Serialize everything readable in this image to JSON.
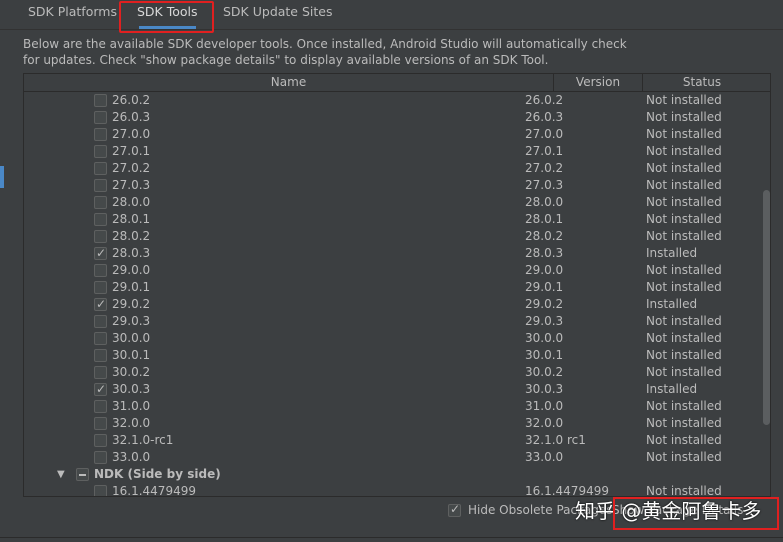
{
  "tabs": [
    {
      "label": "SDK Platforms"
    },
    {
      "label": "SDK Tools"
    },
    {
      "label": "SDK Update Sites"
    }
  ],
  "description": {
    "line1": "Below are the available SDK developer tools. Once installed, Android Studio will automatically check",
    "line2": "for updates. Check \"show package details\" to display available versions of an SDK Tool."
  },
  "table": {
    "headers": {
      "name": "Name",
      "version": "Version",
      "status": "Status"
    },
    "rows": [
      {
        "name": "26.0.2",
        "version": "26.0.2",
        "status": "Not installed",
        "checked": false
      },
      {
        "name": "26.0.3",
        "version": "26.0.3",
        "status": "Not installed",
        "checked": false
      },
      {
        "name": "27.0.0",
        "version": "27.0.0",
        "status": "Not installed",
        "checked": false
      },
      {
        "name": "27.0.1",
        "version": "27.0.1",
        "status": "Not installed",
        "checked": false
      },
      {
        "name": "27.0.2",
        "version": "27.0.2",
        "status": "Not installed",
        "checked": false
      },
      {
        "name": "27.0.3",
        "version": "27.0.3",
        "status": "Not installed",
        "checked": false
      },
      {
        "name": "28.0.0",
        "version": "28.0.0",
        "status": "Not installed",
        "checked": false
      },
      {
        "name": "28.0.1",
        "version": "28.0.1",
        "status": "Not installed",
        "checked": false
      },
      {
        "name": "28.0.2",
        "version": "28.0.2",
        "status": "Not installed",
        "checked": false
      },
      {
        "name": "28.0.3",
        "version": "28.0.3",
        "status": "Installed",
        "checked": true
      },
      {
        "name": "29.0.0",
        "version": "29.0.0",
        "status": "Not installed",
        "checked": false
      },
      {
        "name": "29.0.1",
        "version": "29.0.1",
        "status": "Not installed",
        "checked": false
      },
      {
        "name": "29.0.2",
        "version": "29.0.2",
        "status": "Installed",
        "checked": true
      },
      {
        "name": "29.0.3",
        "version": "29.0.3",
        "status": "Not installed",
        "checked": false
      },
      {
        "name": "30.0.0",
        "version": "30.0.0",
        "status": "Not installed",
        "checked": false
      },
      {
        "name": "30.0.1",
        "version": "30.0.1",
        "status": "Not installed",
        "checked": false
      },
      {
        "name": "30.0.2",
        "version": "30.0.2",
        "status": "Not installed",
        "checked": false
      },
      {
        "name": "30.0.3",
        "version": "30.0.3",
        "status": "Installed",
        "checked": true
      },
      {
        "name": "31.0.0",
        "version": "31.0.0",
        "status": "Not installed",
        "checked": false
      },
      {
        "name": "32.0.0",
        "version": "32.0.0",
        "status": "Not installed",
        "checked": false
      },
      {
        "name": "32.1.0-rc1",
        "version": "32.1.0 rc1",
        "status": "Not installed",
        "checked": false
      },
      {
        "name": "33.0.0",
        "version": "33.0.0",
        "status": "Not installed",
        "checked": false
      }
    ],
    "group": {
      "label": "NDK (Side by side)",
      "expand_icon": "triangle-down-icon"
    },
    "group_rows": [
      {
        "name": "16.1.4479499",
        "version": "16.1.4479499",
        "status": "Not installed",
        "checked": false
      }
    ]
  },
  "footer": {
    "hide_obsolete_label": "Hide Obsolete Packages",
    "show_details_label": "Show Package Details",
    "watermark": "知乎 @黄金阿鲁卡多"
  },
  "colors": {
    "background": "#3c3f41",
    "accent": "#4a88c7",
    "highlight": "#e02020",
    "text": "#bbbbbb"
  }
}
